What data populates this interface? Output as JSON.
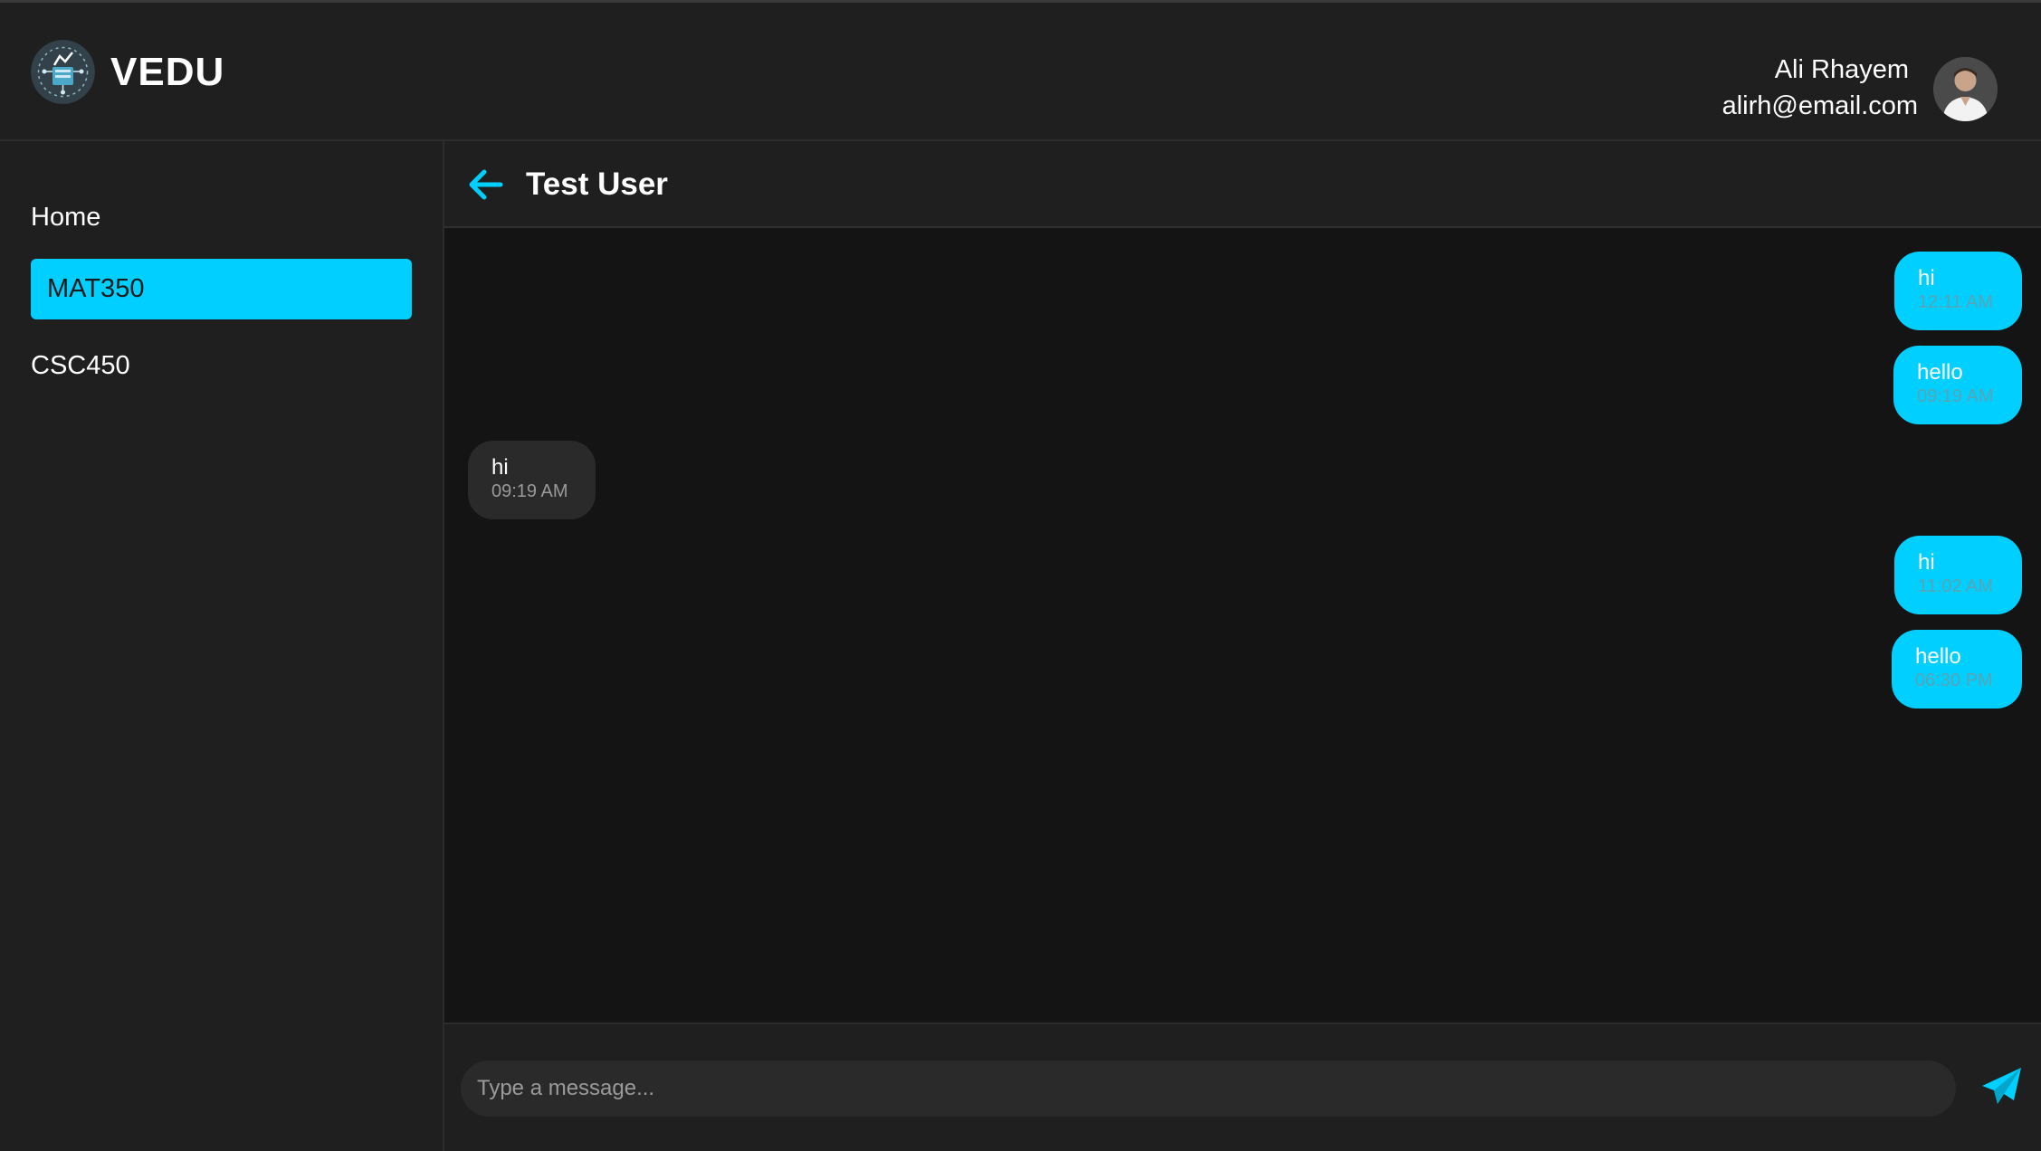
{
  "app": {
    "brand": "VEDU"
  },
  "user": {
    "name": "Ali Rhayem",
    "email": "alirh@email.com"
  },
  "sidebar": {
    "items": [
      {
        "label": "Home",
        "active": false
      },
      {
        "label": "MAT350",
        "active": true
      },
      {
        "label": "CSC450",
        "active": false
      }
    ]
  },
  "chat": {
    "title": "Test User",
    "messages": [
      {
        "text": "hi",
        "time": "12:11 AM",
        "direction": "sent"
      },
      {
        "text": "hello",
        "time": "09:19 AM",
        "direction": "sent"
      },
      {
        "text": "hi",
        "time": "09:19 AM",
        "direction": "received"
      },
      {
        "text": "hi",
        "time": "11:02 AM",
        "direction": "sent"
      },
      {
        "text": "hello",
        "time": "06:30 PM",
        "direction": "sent"
      }
    ]
  },
  "composer": {
    "placeholder": "Type a message..."
  },
  "colors": {
    "accent": "#00cfff",
    "background": "#1f1f1f",
    "chat_background": "#141414"
  }
}
